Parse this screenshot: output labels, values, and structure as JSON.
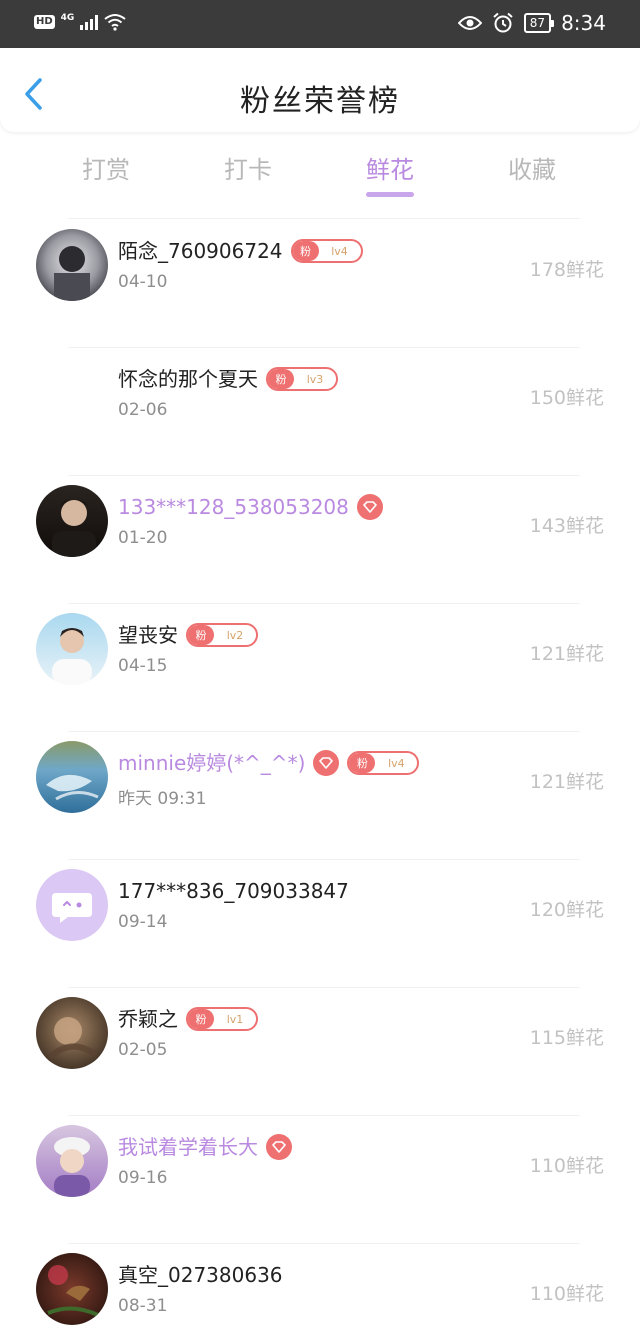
{
  "status_bar": {
    "hd": "HD",
    "network": "4G",
    "battery": "87",
    "time": "8:34"
  },
  "header": {
    "title": "粉丝荣誉榜",
    "back_icon": "chevron-left-icon"
  },
  "tabs": [
    {
      "label": "打赏",
      "active": false
    },
    {
      "label": "打卡",
      "active": false
    },
    {
      "label": "鲜花",
      "active": true
    },
    {
      "label": "收藏",
      "active": false
    }
  ],
  "colors": {
    "accent": "#b98ae0",
    "badge_red": "#ee7070",
    "level_text": "#d6a36a",
    "count_gray": "#c2c2c2"
  },
  "rows": [
    {
      "name": "陌念_760906724",
      "name_color": "default",
      "vip": false,
      "fan_label": "粉",
      "level": "lv4",
      "date": "04-10",
      "count": "178鲜花"
    },
    {
      "name": "怀念的那个夏天",
      "name_color": "default",
      "vip": false,
      "fan_label": "粉",
      "level": "lv3",
      "date": "02-06",
      "count": "150鲜花"
    },
    {
      "name": "133***128_538053208",
      "name_color": "purple",
      "vip": true,
      "fan_label": "",
      "level": "",
      "date": "01-20",
      "count": "143鲜花"
    },
    {
      "name": "望丧安",
      "name_color": "default",
      "vip": false,
      "fan_label": "粉",
      "level": "lv2",
      "date": "04-15",
      "count": "121鲜花"
    },
    {
      "name": "minnie婷婷(*^_^*)",
      "name_color": "purple",
      "vip": true,
      "fan_label": "粉",
      "level": "lv4",
      "date": "昨天 09:31",
      "count": "121鲜花"
    },
    {
      "name": "177***836_709033847",
      "name_color": "default",
      "vip": false,
      "fan_label": "",
      "level": "",
      "date": "09-14",
      "count": "120鲜花"
    },
    {
      "name": "乔颖之",
      "name_color": "default",
      "vip": false,
      "fan_label": "粉",
      "level": "lv1",
      "date": "02-05",
      "count": "115鲜花"
    },
    {
      "name": "我试着学着长大",
      "name_color": "purple",
      "vip": true,
      "fan_label": "",
      "level": "",
      "date": "09-16",
      "count": "110鲜花"
    },
    {
      "name": "真空_027380636",
      "name_color": "default",
      "vip": false,
      "fan_label": "",
      "level": "",
      "date": "08-31",
      "count": "110鲜花"
    }
  ]
}
